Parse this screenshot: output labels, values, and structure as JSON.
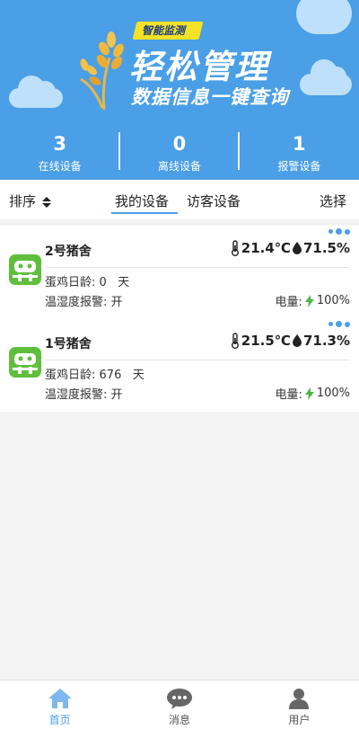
{
  "banner": {
    "tag": "智能监测",
    "title": "轻松管理",
    "subtitle": "数据信息一键查询",
    "colors": {
      "background": "#4a9fe6",
      "tag": "#f4e227",
      "cloud": "#bfe0fb"
    }
  },
  "stats": [
    {
      "value": "3",
      "label": "在线设备"
    },
    {
      "value": "0",
      "label": "离线设备"
    },
    {
      "value": "1",
      "label": "报警设备"
    }
  ],
  "toolbar": {
    "sort_label": "排序",
    "tabs": [
      {
        "label": "我的设备",
        "active": true
      },
      {
        "label": "访客设备",
        "active": false
      }
    ],
    "select_label": "选择"
  },
  "devices": [
    {
      "name": "2号猪舍",
      "temperature": "21.4℃",
      "humidity": "71.5%",
      "age_label": "蛋鸡日龄:",
      "age_value": "0",
      "age_unit": "天",
      "alarm_label": "温湿度报警:",
      "alarm_value": "开",
      "power_label": "电量:",
      "power_value": "100%"
    },
    {
      "name": "1号猪舍",
      "temperature": "21.5℃",
      "humidity": "71.3%",
      "age_label": "蛋鸡日龄:",
      "age_value": "676",
      "age_unit": "天",
      "alarm_label": "温湿度报警:",
      "alarm_value": "开",
      "power_label": "电量:",
      "power_value": "100%"
    }
  ],
  "nav": [
    {
      "label": "首页",
      "icon": "home-icon",
      "active": true
    },
    {
      "label": "消息",
      "icon": "chat-icon",
      "active": false
    },
    {
      "label": "用户",
      "icon": "user-icon",
      "active": false
    }
  ],
  "accent_color": "#4a9fe6",
  "device_icon_color": "#5fbf3c",
  "power_icon_color": "#4cb34a"
}
